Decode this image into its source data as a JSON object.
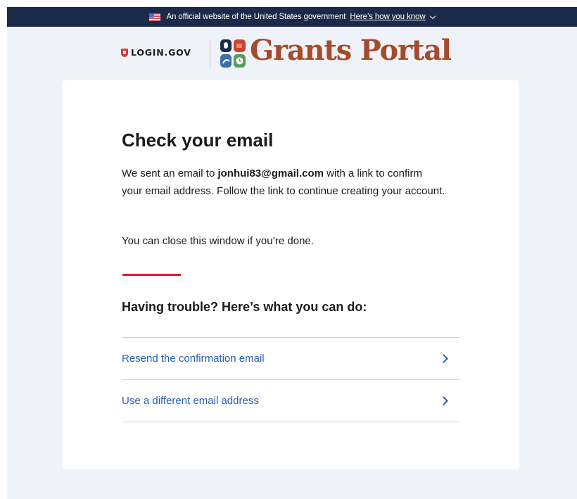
{
  "gov_banner": {
    "text": "An official website of the United States government",
    "link_label": "Here’s how you know"
  },
  "header": {
    "login_logo_text": "LOGIN.GOV",
    "grants_title": "Grants Portal"
  },
  "main": {
    "title": "Check your email",
    "paragraph1": {
      "prefix": "We sent an email to ",
      "email": "jonhui83@gmail.com",
      "suffix": " with a link to confirm your email address. Follow the link to continue creating your account."
    },
    "paragraph2": "You can close this window if you’re done.",
    "subheading": "Having trouble? Here’s what you can do:",
    "options": [
      {
        "label": "Resend the confirmation email"
      },
      {
        "label": "Use a different email address"
      }
    ]
  },
  "colors": {
    "banner_bg": "#1b2a48",
    "page_bg": "#eff3f9",
    "link": "#2a5fb0",
    "accent_red": "#d71e3a",
    "grants_brand": "#a54a2a"
  }
}
